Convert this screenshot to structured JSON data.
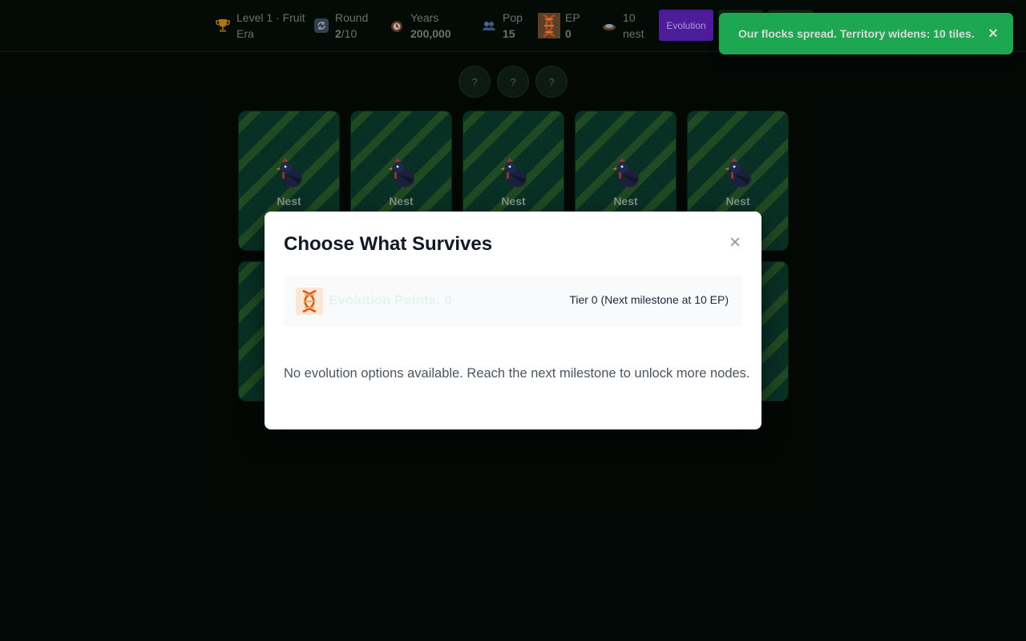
{
  "hud": {
    "level_line1": "Level 1 · Fruit",
    "level_line2": "Era",
    "round_label": "Round",
    "round_current": "2",
    "round_total": "/10",
    "years_label": "Years",
    "years_value": "200,000",
    "pop_label": "Pop",
    "pop_value": "15",
    "ep_label": "EP",
    "ep_value": "0",
    "nest_count": "10",
    "nest_label": "nest",
    "evolution_button": "Evolution"
  },
  "icons": {
    "level": "trophy-icon",
    "round": "refresh-icon",
    "years": "clock-icon",
    "pop": "people-icon",
    "ep": "dna-icon",
    "nest": "nest-icon"
  },
  "toast": {
    "message": "Our flocks spread. Territory widens: 10 tiles.",
    "close": "×"
  },
  "mystery": [
    "?",
    "?",
    "?"
  ],
  "tiles": [
    {
      "label": "Nest"
    },
    {
      "label": "Nest"
    },
    {
      "label": "Nest"
    },
    {
      "label": "Nest"
    },
    {
      "label": "Nest"
    },
    {
      "label": ""
    },
    {
      "label": ""
    },
    {
      "label": ""
    },
    {
      "label": ""
    },
    {
      "label": ""
    }
  ],
  "modal": {
    "title": "Choose What Survives",
    "close": "×",
    "ep_text": "Evolution Points: 0",
    "tier_text": "Tier 0 (Next milestone at 10 EP)",
    "empty_text": "No evolution options available. Reach the next milestone to unlock more nodes."
  },
  "colors": {
    "background": "#040a07",
    "toast": "#22c55e",
    "evolution_button": "#5b21b6",
    "tile": "#0b3a2a"
  }
}
